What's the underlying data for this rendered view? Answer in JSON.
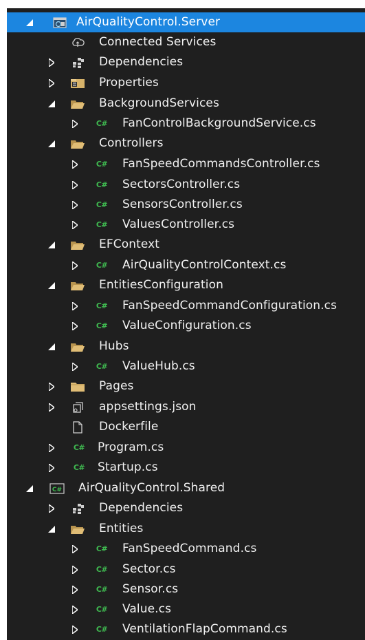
{
  "solution_explorer": {
    "projects": [
      {
        "name": "AirQualityControl.Server",
        "children": [
          {
            "label": "Connected Services"
          },
          {
            "label": "Dependencies"
          },
          {
            "label": "Properties"
          },
          {
            "label": "BackgroundServices",
            "children": [
              "FanControlBackgroundService.cs"
            ]
          },
          {
            "label": "Controllers",
            "children": [
              "FanSpeedCommandsController.cs",
              "SectorsController.cs",
              "SensorsController.cs",
              "ValuesController.cs"
            ]
          },
          {
            "label": "EFContext",
            "children": [
              "AirQualityControlContext.cs"
            ]
          },
          {
            "label": "EntitiesConfiguration",
            "children": [
              "FanSpeedCommandConfiguration.cs",
              "ValueConfiguration.cs"
            ]
          },
          {
            "label": "Hubs",
            "children": [
              "ValueHub.cs"
            ]
          },
          {
            "label": "Pages"
          },
          {
            "label": "appsettings.json"
          },
          {
            "label": "Dockerfile"
          },
          {
            "label": "Program.cs"
          },
          {
            "label": "Startup.cs"
          }
        ]
      },
      {
        "name": "AirQualityControl.Shared",
        "children": [
          {
            "label": "Dependencies"
          },
          {
            "label": "Entities",
            "children": [
              "FanSpeedCommand.cs",
              "Sector.cs",
              "Sensor.cs",
              "Value.cs",
              "VentilationFlapCommand.cs"
            ]
          }
        ]
      }
    ]
  },
  "colors": {
    "background": "#1f1f1f",
    "selection": "#1c86e0",
    "text": "#f1f1f1",
    "csharp_icon": "#3fb950",
    "folder": "#d7b36a"
  }
}
